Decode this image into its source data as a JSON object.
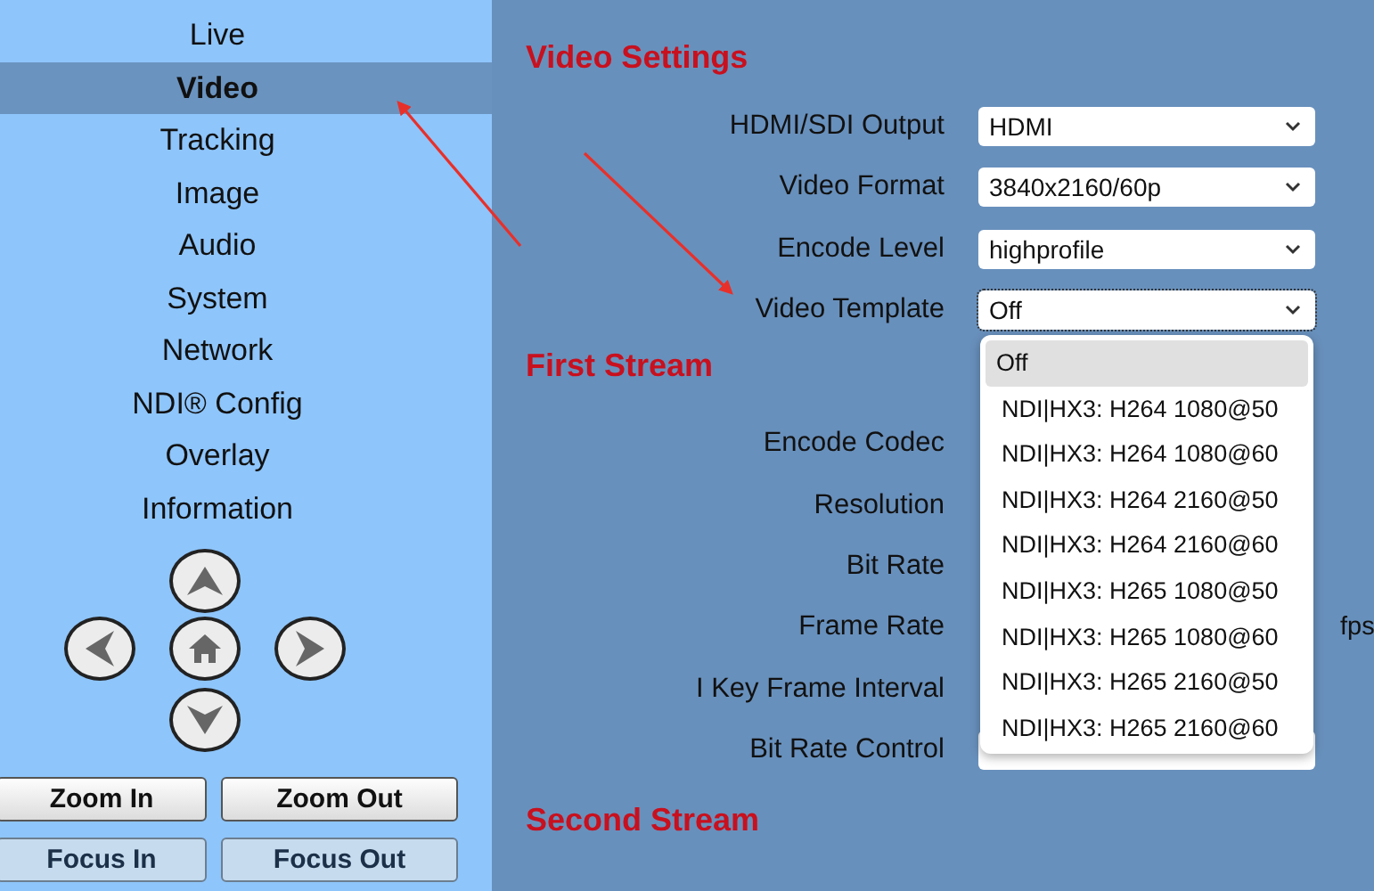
{
  "nav": [
    {
      "label": "Live",
      "selected": false
    },
    {
      "label": "Video",
      "selected": true
    },
    {
      "label": "Tracking",
      "selected": false
    },
    {
      "label": "Image",
      "selected": false
    },
    {
      "label": "Audio",
      "selected": false
    },
    {
      "label": "System",
      "selected": false
    },
    {
      "label": "Network",
      "selected": false
    },
    {
      "label": "NDI® Config",
      "selected": false
    },
    {
      "label": "Overlay",
      "selected": false
    },
    {
      "label": "Information",
      "selected": false
    }
  ],
  "lens_buttons": [
    {
      "label": "Zoom In",
      "kind": "zoom"
    },
    {
      "label": "Zoom Out",
      "kind": "zoom"
    },
    {
      "label": "Focus In",
      "kind": "focus"
    },
    {
      "label": "Focus Out",
      "kind": "focus"
    }
  ],
  "video_settings": {
    "heading": "Video Settings",
    "fields": [
      {
        "label": "HDMI/SDI Output",
        "value": "HDMI",
        "open": false
      },
      {
        "label": "Video Format",
        "value": "3840x2160/60p",
        "open": false
      },
      {
        "label": "Encode Level",
        "value": "highprofile",
        "open": false
      },
      {
        "label": "Video Template",
        "value": "Off",
        "open": true
      }
    ]
  },
  "template_dropdown": {
    "options": [
      {
        "label": "Off",
        "selected": true
      },
      {
        "label": "NDI|HX3: H264 1080@50",
        "selected": false
      },
      {
        "label": "NDI|HX3: H264 1080@60",
        "selected": false
      },
      {
        "label": "NDI|HX3: H264 2160@50",
        "selected": false
      },
      {
        "label": "NDI|HX3: H264 2160@60",
        "selected": false
      },
      {
        "label": "NDI|HX3: H265 1080@50",
        "selected": false
      },
      {
        "label": "NDI|HX3: H265 1080@60",
        "selected": false
      },
      {
        "label": "NDI|HX3: H265 2160@50",
        "selected": false
      },
      {
        "label": "NDI|HX3: H265 2160@60",
        "selected": false
      }
    ]
  },
  "first_stream": {
    "heading": "First Stream",
    "fields": [
      {
        "label": "Encode Codec"
      },
      {
        "label": "Resolution"
      },
      {
        "label": "Bit Rate"
      },
      {
        "label": "Frame Rate",
        "unit": "fps"
      },
      {
        "label": "I Key Frame Interval"
      },
      {
        "label": "Bit Rate Control",
        "kind": "select"
      }
    ]
  },
  "second_stream": {
    "heading": "Second Stream"
  }
}
